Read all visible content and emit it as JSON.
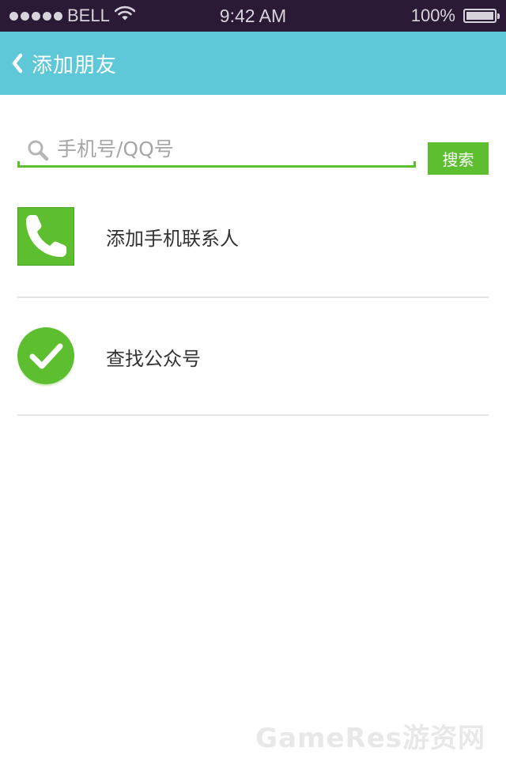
{
  "status_bar": {
    "carrier": "BELL",
    "time": "9:42 AM",
    "battery": "100%",
    "battery_level": 1.0,
    "signal_icon": "signal-dots-icon",
    "wifi_icon": "wifi-icon"
  },
  "nav": {
    "back_icon": "chevron-left-icon",
    "title": "添加朋友"
  },
  "search": {
    "placeholder": "手机号/QQ号",
    "value": "",
    "button_label": "搜索",
    "icon": "search-icon"
  },
  "list": {
    "items": [
      {
        "label": "添加手机联系人",
        "icon": "phone-icon"
      },
      {
        "label": "查找公众号",
        "icon": "checkmark-icon"
      }
    ]
  },
  "watermark": "GameRes游资网",
  "colors": {
    "status_bar": "#2a1a36",
    "nav_bar": "#5ec8d8",
    "accent_green": "#5dbf2f",
    "divider": "#e4e4e4"
  }
}
